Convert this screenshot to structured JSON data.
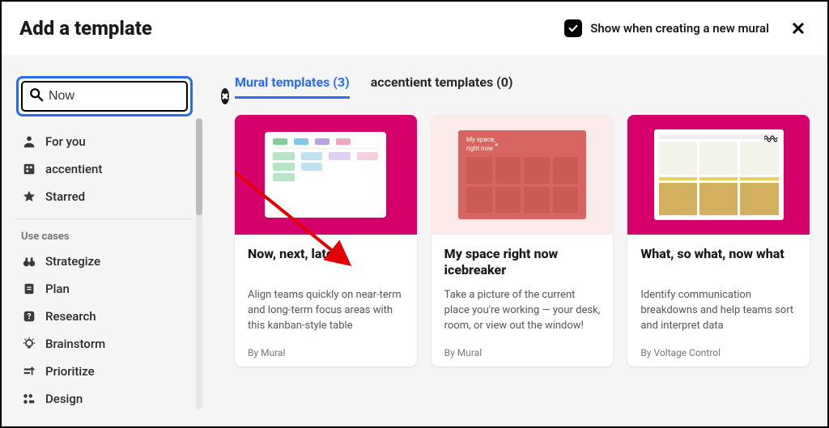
{
  "header": {
    "title": "Add a template",
    "toggle_label": "Show when creating a new mural",
    "toggle_checked": true
  },
  "search": {
    "value": "Now",
    "placeholder": ""
  },
  "sidebar": {
    "primary": [
      {
        "icon": "person",
        "label": "For you"
      },
      {
        "icon": "building",
        "label": "accentient"
      },
      {
        "icon": "star",
        "label": "Starred"
      }
    ],
    "section_label": "Use cases",
    "usecases": [
      {
        "icon": "binoculars",
        "label": "Strategize"
      },
      {
        "icon": "doc",
        "label": "Plan"
      },
      {
        "icon": "question",
        "label": "Research"
      },
      {
        "icon": "bulb",
        "label": "Brainstorm"
      },
      {
        "icon": "prioritize",
        "label": "Prioritize"
      },
      {
        "icon": "design",
        "label": "Design"
      }
    ]
  },
  "tabs": [
    {
      "label": "Mural templates (3)",
      "active": true
    },
    {
      "label": "accentient templates (0)",
      "active": false
    }
  ],
  "cards": [
    {
      "title": "Now, next, later",
      "desc": "Align teams quickly on near-term and long-term focus areas with this kanban-style table",
      "author": "By Mural",
      "thumb": "kanban"
    },
    {
      "title": "My space right now icebreaker",
      "desc": "Take a picture of the current place you're working — your desk, room, or view out the window!",
      "author": "By Mural",
      "thumb": "grid"
    },
    {
      "title": "What, so what, now what",
      "desc": "Identify communication breakdowns and help teams sort and interpret data",
      "author": "By Voltage Control",
      "thumb": "retro"
    }
  ],
  "colors": {
    "accent": "#2a6cf0",
    "magenta": "#d6006c"
  }
}
